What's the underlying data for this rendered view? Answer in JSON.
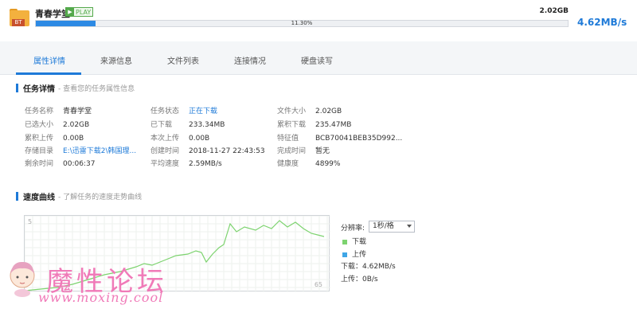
{
  "header": {
    "title": "青春学堂",
    "icon_label": "BT",
    "play_label": "PLAY",
    "total_size": "2.02GB",
    "progress_percent": 11.3,
    "progress_label": "11.30%",
    "speed": "4.62MB/s"
  },
  "tabs": [
    {
      "label": "属性详情",
      "active": true
    },
    {
      "label": "来源信息",
      "active": false
    },
    {
      "label": "文件列表",
      "active": false
    },
    {
      "label": "连接情况",
      "active": false
    },
    {
      "label": "硬盘读写",
      "active": false
    }
  ],
  "task_details": {
    "heading": "任务详情",
    "subheading": "- 查看您的任务属性信息",
    "col1": [
      {
        "key": "任务名称",
        "value": "青春学堂"
      },
      {
        "key": "已选大小",
        "value": "2.02GB"
      },
      {
        "key": "累积上传",
        "value": "0.00B"
      },
      {
        "key": "存储目录",
        "value": "E:\\迅雷下载2\\韩国理..."
      },
      {
        "key": "剩余时间",
        "value": "00:06:37"
      }
    ],
    "col2": [
      {
        "key": "任务状态",
        "value": "正在下载"
      },
      {
        "key": "已下载",
        "value": "233.34MB"
      },
      {
        "key": "本次上传",
        "value": "0.00B"
      },
      {
        "key": "创建时间",
        "value": "2018-11-27 22:43:53"
      },
      {
        "key": "平均速度",
        "value": "2.59MB/s"
      }
    ],
    "col3": [
      {
        "key": "文件大小",
        "value": "2.02GB"
      },
      {
        "key": "累积下载",
        "value": "235.47MB"
      },
      {
        "key": "特征值",
        "value": "BCB70041BEB35D992..."
      },
      {
        "key": "完成时间",
        "value": "暂无"
      },
      {
        "key": "健康度",
        "value": "4899%"
      }
    ]
  },
  "speed_curve": {
    "heading": "速度曲线",
    "subheading": "- 了解任务的速度走势曲线",
    "axis_top": "5",
    "axis_bottom": "65",
    "resolution_label": "分辨率:",
    "resolution_value": "1秒/格",
    "legend_download": "下载",
    "legend_upload": "上传",
    "download_speed": "下载：4.62MB/s",
    "upload_speed": "上传：0B/s",
    "colors": {
      "download": "#7dd36f",
      "upload": "#3fa6e6"
    }
  },
  "watermark": {
    "text": "魔性论坛",
    "url": "www.moxing.cool"
  }
}
